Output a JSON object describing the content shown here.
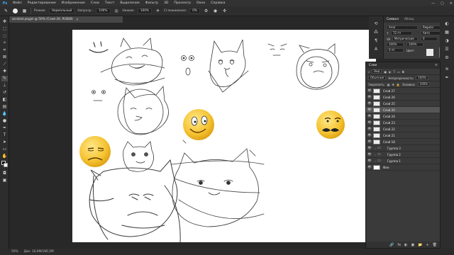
{
  "menubar": {
    "logo": "Ps",
    "items": [
      "Файл",
      "Редактирование",
      "Изображение",
      "Слои",
      "Текст",
      "Выделение",
      "Фильтр",
      "3D",
      "Просмотр",
      "Окно",
      "Справка"
    ],
    "window_controls": [
      "—",
      "▢",
      "✕"
    ]
  },
  "options": {
    "mode_label": "Режим:",
    "mode_value": "Нормальный",
    "opacity_label": "Непрозр.:",
    "opacity_value": "100%",
    "flow_label": "Нажим:",
    "flow_value": "100%",
    "smoothing_label": "Сглаживание:",
    "smoothing_value": "0%"
  },
  "document": {
    "tab_title": "acrobat.pngat @ 50% (Слой 26, RGB/8)",
    "close": "×"
  },
  "status": {
    "zoom": "50%",
    "doc_info": "Док: 10,0M/166,5M"
  },
  "swatches_panel": {
    "tabs": [
      "Символ",
      "Абзац"
    ],
    "font_family": "Arial",
    "font_style": "Regular",
    "size_label": "Т",
    "size_value": "72 пт",
    "leading_value": "Авто",
    "tracking_label": "VA",
    "tracking_value": "0",
    "kerning_label": "Метрические",
    "scale_v": "100%",
    "scale_h": "100%",
    "baseline": "0 пт",
    "color_label": "Цвет:"
  },
  "layers_panel": {
    "tab": "Слои",
    "filter_label": "Вид",
    "blend_value": "Обычные",
    "opacity_label": "Непрозрачность:",
    "opacity_value": "100%",
    "lock_label": "Закрепить:",
    "fill_label": "Заливка:",
    "fill_value": "100%",
    "layers": [
      {
        "name": "Слой 27",
        "kind": "pixel",
        "selected": false
      },
      {
        "name": "Слой 26",
        "kind": "pixel",
        "selected": false
      },
      {
        "name": "Слой 25",
        "kind": "pixel",
        "selected": false
      },
      {
        "name": "Слой 20",
        "kind": "pixel",
        "selected": true
      },
      {
        "name": "Слой 24",
        "kind": "pixel",
        "selected": false
      },
      {
        "name": "Слой 23",
        "kind": "pixel",
        "selected": false
      },
      {
        "name": "Слой 22",
        "kind": "pixel",
        "selected": false
      },
      {
        "name": "Слой 21",
        "kind": "pixel",
        "selected": false
      },
      {
        "name": "Слой 18",
        "kind": "pixel",
        "selected": false
      },
      {
        "name": "Группа 3",
        "kind": "group",
        "selected": false
      },
      {
        "name": "Группа 2",
        "kind": "group",
        "selected": false
      },
      {
        "name": "Группа 1",
        "kind": "group",
        "selected": false
      },
      {
        "name": "Фон",
        "kind": "background",
        "selected": false
      }
    ],
    "bottom_icons": [
      "🔗",
      "fx",
      "◐",
      "▣",
      "📁",
      "+",
      "🗑"
    ]
  },
  "colors": {
    "accent": "#31a8ff",
    "emoji_yellow": "#f5c331",
    "canvas": "#ffffff",
    "ui_dark": "#2d2d2d"
  }
}
